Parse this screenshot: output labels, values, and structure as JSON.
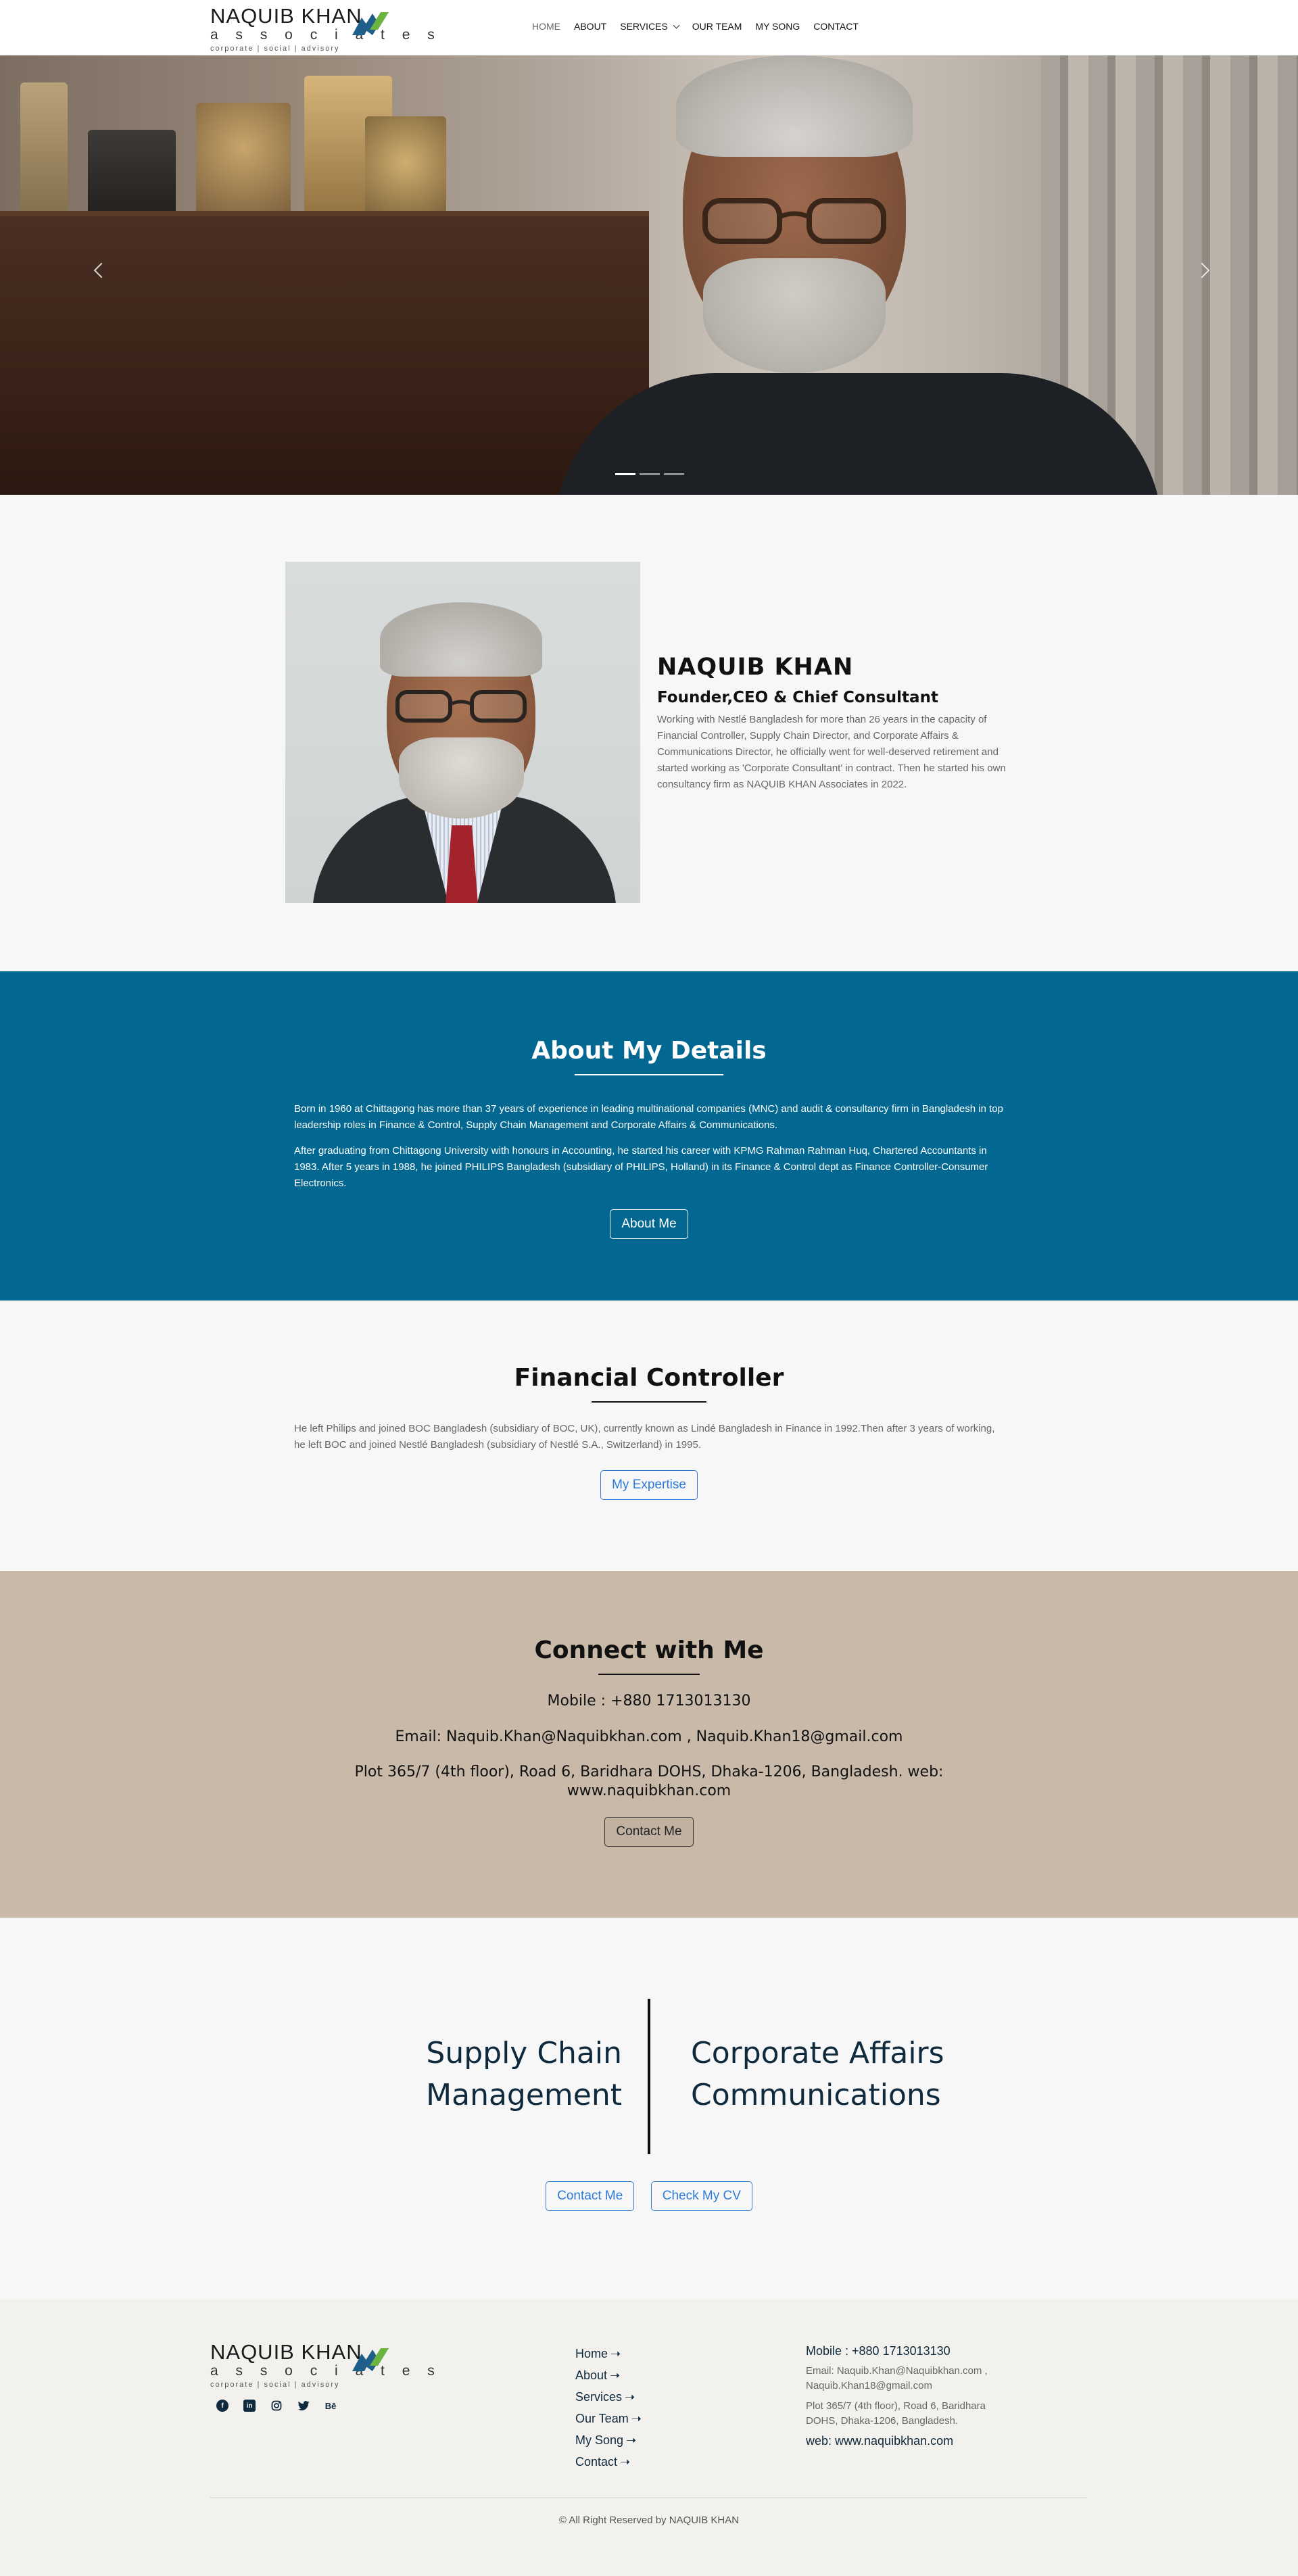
{
  "brand": {
    "name": "NAQUIB KHAN",
    "sub": "a s s o c i a t e s",
    "tagline": "corporate  |  social  |  advisory",
    "accent_green": "#6db33f",
    "accent_blue": "#1e5f8a"
  },
  "nav": {
    "items": [
      {
        "label": "HOME",
        "active": true
      },
      {
        "label": "ABOUT"
      },
      {
        "label": "SERVICES",
        "has_dropdown": true
      },
      {
        "label": "OUR TEAM"
      },
      {
        "label": "MY SONG"
      },
      {
        "label": "CONTACT"
      }
    ]
  },
  "hero": {
    "prev_icon": "chevron-left-icon",
    "next_icon": "chevron-right-icon",
    "slides": 3,
    "active_slide": 1
  },
  "profile": {
    "name": "NAQUIB KHAN",
    "role": "Founder,CEO & Chief Consultant",
    "bio": "Working with Nestlé Bangladesh for more than 26 years in the capacity of Financial Controller, Supply Chain Director, and Corporate Affairs & Communications Director, he officially went for well-deserved retirement and started working as 'Corporate Consultant' in contract. Then he started his own consultancy firm as NAQUIB KHAN Associates in 2022."
  },
  "details": {
    "title": "About My Details",
    "para1": "Born in 1960 at Chittagong has more than 37 years of experience in leading multinational companies (MNC) and audit & consultancy firm in Bangladesh in top leadership roles in Finance & Control, Supply Chain Management and Corporate Affairs & Communications.",
    "para2": "After graduating from Chittagong University with honours in Accounting, he started his career with KPMG Rahman Rahman Huq, Chartered Accountants in 1983. After 5 years in 1988, he joined PHILIPS Bangladesh (subsidiary of PHILIPS, Holland) in its Finance & Control dept as Finance Controller-Consumer Electronics.",
    "button": "About Me",
    "bg": "#026891"
  },
  "financial": {
    "title": "Financial Controller",
    "text": "He left Philips and joined BOC Bangladesh (subsidiary of BOC, UK), currently known as Lindé Bangladesh in Finance in 1992.Then after 3 years of working, he left BOC and joined Nestlé Bangladesh (subsidiary of Nestlé S.A., Switzerland) in 1995.",
    "button": "My Expertise"
  },
  "connect": {
    "title": "Connect with Me",
    "mobile": "Mobile : +880 1713013130",
    "email": "Email: Naquib.Khan@Naquibkhan.com , Naquib.Khan18@gmail.com",
    "address": "Plot 365/7 (4th floor), Road 6, Baridhara DOHS, Dhaka-1206, Bangladesh. web: www.naquibkhan.com",
    "button": "Contact Me",
    "bg": "#c8b9a8"
  },
  "expertise": {
    "left_line1": "Supply Chain",
    "left_line2": "Management",
    "right_line1": "Corporate Affairs",
    "right_line2": "Communications",
    "btn_contact": "Contact Me",
    "btn_cv": "Check My CV"
  },
  "footer": {
    "social": [
      "facebook-icon",
      "linkedin-icon",
      "instagram-icon",
      "twitter-icon",
      "behance-icon"
    ],
    "behance_label": "Bē",
    "links": [
      "Home",
      "About",
      "Services",
      "Our Team",
      "My Song",
      "Contact"
    ],
    "arrow": "➝",
    "mobile": "Mobile : +880 1713013130",
    "email": "Email: Naquib.Khan@Naquibkhan.com , Naquib.Khan18@gmail.com",
    "address": "Plot 365/7 (4th floor), Road 6, Baridhara DOHS, Dhaka-1206, Bangladesh.",
    "web": "web: www.naquibkhan.com",
    "copyright": "© All Right Reserved by NAQUIB KHAN"
  }
}
